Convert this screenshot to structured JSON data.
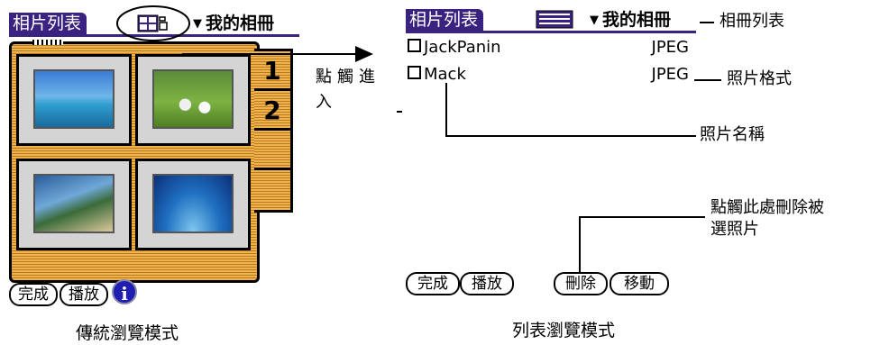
{
  "left_screen": {
    "title": "相片列表",
    "album_dropdown": "我的相冊",
    "page_tabs": [
      "1",
      "2"
    ],
    "buttons": {
      "done": "完成",
      "play": "播放"
    },
    "caption": "傳統瀏覽模式"
  },
  "right_screen": {
    "title": "相片列表",
    "album_dropdown": "我的相冊",
    "photos": [
      {
        "name": "JackPanin",
        "format": "JPEG"
      },
      {
        "name": "Mack",
        "format": "JPEG"
      }
    ],
    "buttons": {
      "done": "完成",
      "play": "播放",
      "delete": "刪除",
      "move": "移動"
    },
    "caption": "列表瀏覽模式"
  },
  "annotations": {
    "tap_enter": "點觸進入",
    "album_list": "相冊列表",
    "photo_format": "照片格式",
    "photo_name": "照片名稱",
    "delete_hint_line1": "點觸此處刪除被",
    "delete_hint_line2": "選照片"
  }
}
